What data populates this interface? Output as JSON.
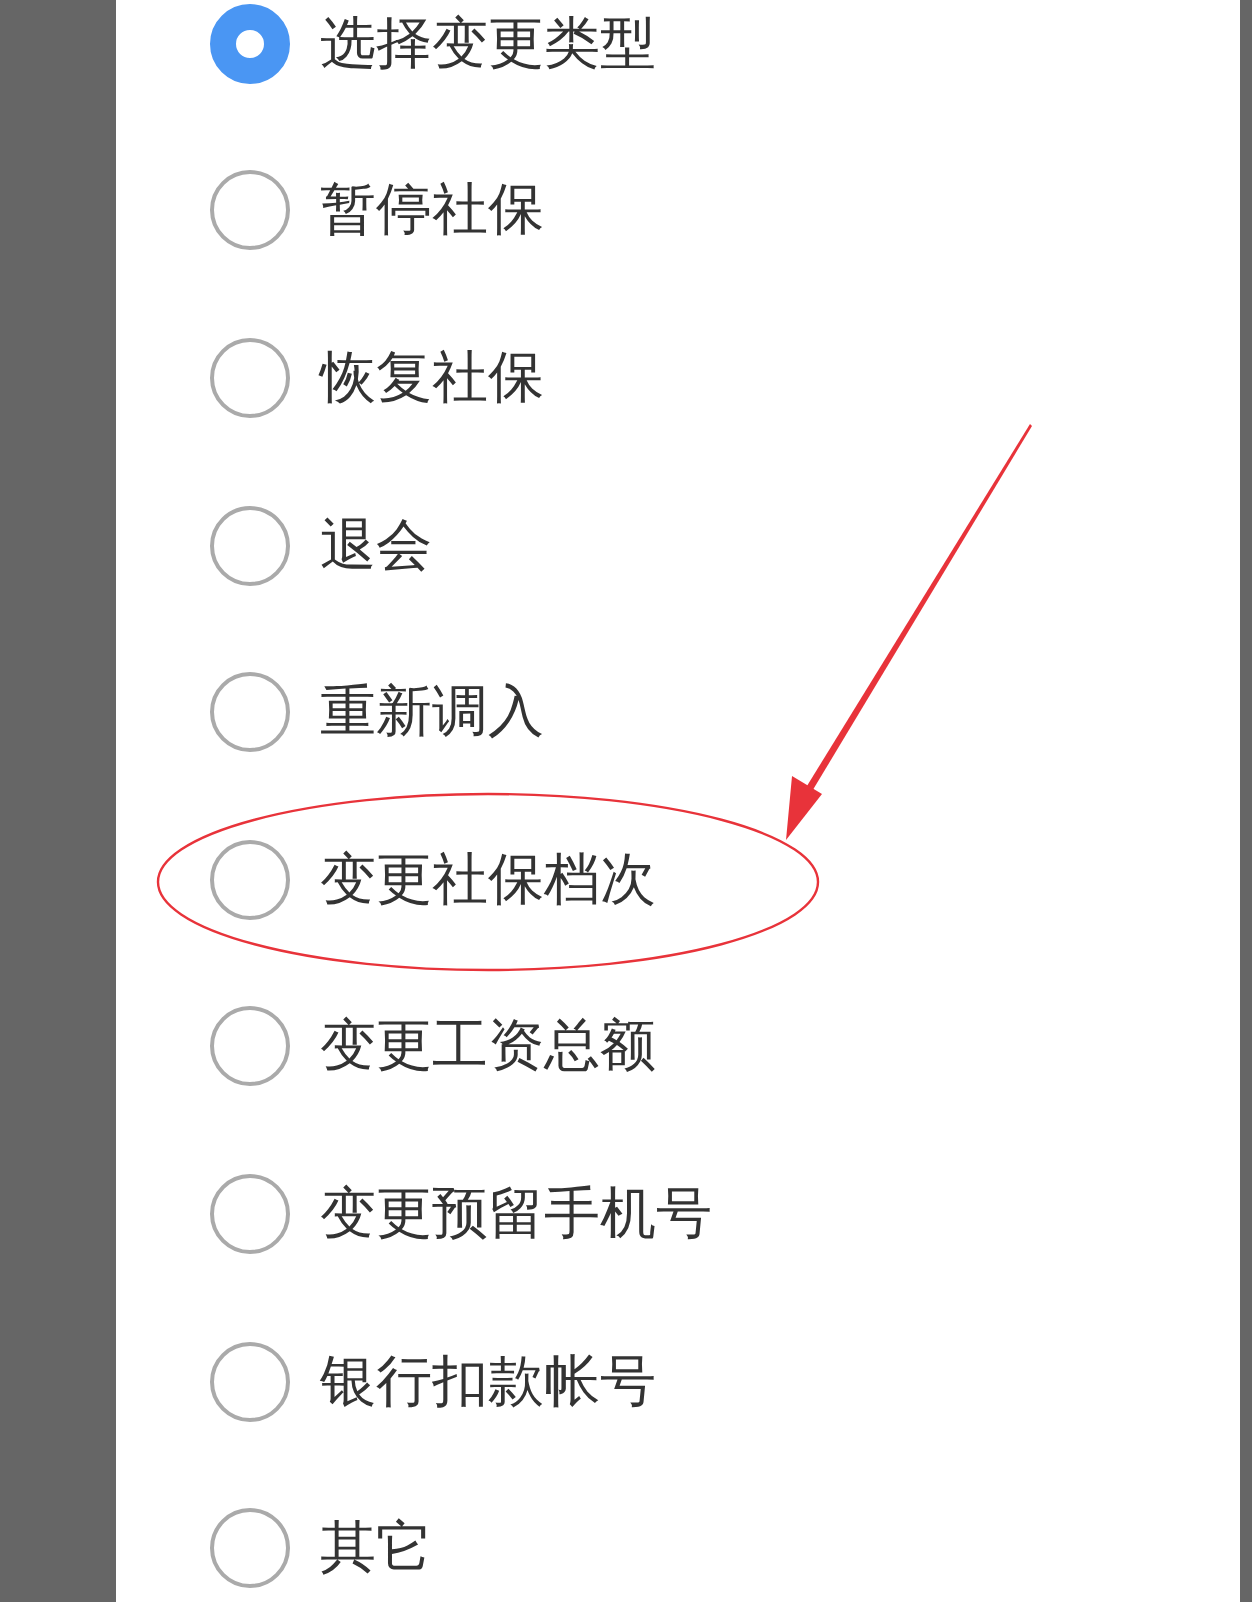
{
  "options": [
    {
      "label": "选择变更类型",
      "selected": true,
      "highlighted": false
    },
    {
      "label": "暂停社保",
      "selected": false,
      "highlighted": false
    },
    {
      "label": "恢复社保",
      "selected": false,
      "highlighted": false
    },
    {
      "label": "退会",
      "selected": false,
      "highlighted": false
    },
    {
      "label": "重新调入",
      "selected": false,
      "highlighted": false
    },
    {
      "label": "变更社保档次",
      "selected": false,
      "highlighted": true
    },
    {
      "label": "变更工资总额",
      "selected": false,
      "highlighted": false
    },
    {
      "label": "变更预留手机号",
      "selected": false,
      "highlighted": false
    },
    {
      "label": "银行扣款帐号",
      "selected": false,
      "highlighted": false
    },
    {
      "label": "其它",
      "selected": false,
      "highlighted": false
    }
  ]
}
